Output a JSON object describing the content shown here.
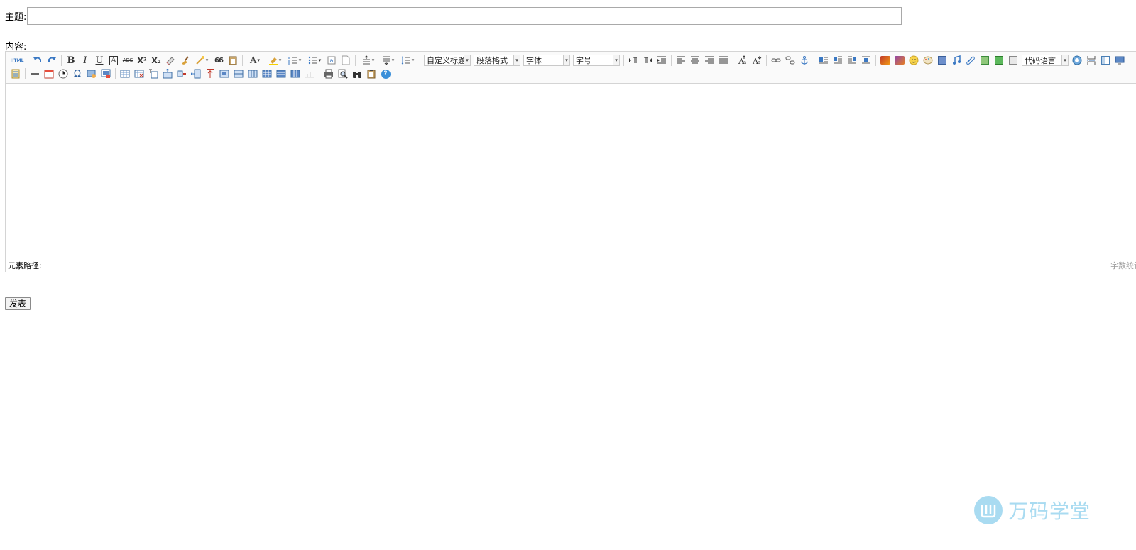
{
  "form": {
    "subject_label": "主题:",
    "subject_value": "",
    "content_label": "内容:",
    "publish_label": "发表"
  },
  "toolbar": {
    "selects": {
      "heading": "自定义标题",
      "paragraph": "段落格式",
      "font_family": "字体",
      "font_size": "字号",
      "code_language": "代码语言"
    },
    "glyphs": {
      "html": "HTML",
      "bold": "B",
      "italic": "I",
      "underline": "U",
      "font_border": "A",
      "strike": "ABC",
      "superscript": "X²",
      "subscript": "X₂",
      "quote": "66",
      "forecolor": "A",
      "omega": "Ω",
      "help": "?"
    }
  },
  "statusbar": {
    "path_label": "元素路径:",
    "word_count": "字数统计"
  },
  "watermark": {
    "text": "万码学堂"
  },
  "colors": {
    "accent_blue": "#3a78c3",
    "watermark": "#a9dbf1",
    "border": "#d4d4d4"
  }
}
